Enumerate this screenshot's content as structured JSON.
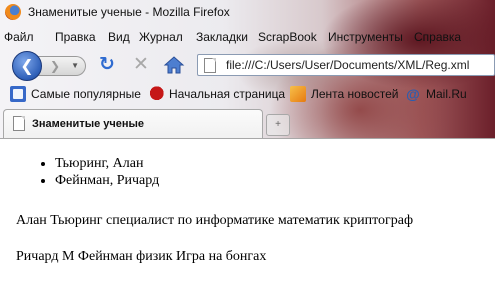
{
  "window": {
    "title": "Знаменитые ученые - Mozilla Firefox"
  },
  "menu": {
    "items": [
      {
        "label": "Файл",
        "name": "menu-file"
      },
      {
        "label": "Правка",
        "name": "menu-edit"
      },
      {
        "label": "Вид",
        "name": "menu-view"
      },
      {
        "label": "Журнал",
        "name": "menu-history"
      },
      {
        "label": "Закладки",
        "name": "menu-bookmarks"
      },
      {
        "label": "ScrapBook",
        "name": "menu-scrapbook"
      },
      {
        "label": "Инструменты",
        "name": "menu-tools"
      },
      {
        "label": "Справка",
        "name": "menu-help"
      }
    ]
  },
  "nav": {
    "back_glyph": "❮",
    "forward_glyph": "❯",
    "reload_glyph": "↻",
    "stop_glyph": "✕",
    "url": "file:///C:/Users/User/Documents/XML/Reg.xml"
  },
  "bookmarks": {
    "items": [
      {
        "label": "Самые популярные",
        "icon": "most-visited-icon"
      },
      {
        "label": "Начальная страница",
        "icon": "start-page-icon"
      },
      {
        "label": "Лента новостей",
        "icon": "rss-feed-icon"
      },
      {
        "label": "Mail.Ru",
        "icon": "mail-ru-icon"
      }
    ]
  },
  "tabs": {
    "active_label": "Знаменитые ученые"
  },
  "document": {
    "list": [
      "Тьюринг, Алан",
      "Фейнман, Ричард"
    ],
    "paragraphs": [
      "Алан Тьюринг специалист по информатике математик криптограф",
      "Ричард М Фейнман физик Игра на бонгах"
    ]
  }
}
